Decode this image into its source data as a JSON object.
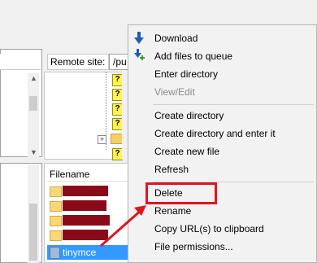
{
  "remote": {
    "label": "Remote site:",
    "path": "/pu"
  },
  "file_list": {
    "column_header": "Filename",
    "selected_file": "tinymce"
  },
  "context_menu": {
    "items": [
      {
        "label": "Download"
      },
      {
        "label": "Add files to queue"
      },
      {
        "label": "Enter directory"
      },
      {
        "label": "View/Edit"
      },
      {
        "label": "Create directory"
      },
      {
        "label": "Create directory and enter it"
      },
      {
        "label": "Create new file"
      },
      {
        "label": "Refresh"
      },
      {
        "label": "Delete"
      },
      {
        "label": "Rename"
      },
      {
        "label": "Copy URL(s) to clipboard"
      },
      {
        "label": "File permissions..."
      }
    ]
  },
  "tree": {
    "unknown_marker": "?",
    "expand_marker": "+"
  },
  "colors": {
    "highlight": "#e0141e",
    "selection": "#3399ff",
    "redaction": "#8b0a1a"
  }
}
